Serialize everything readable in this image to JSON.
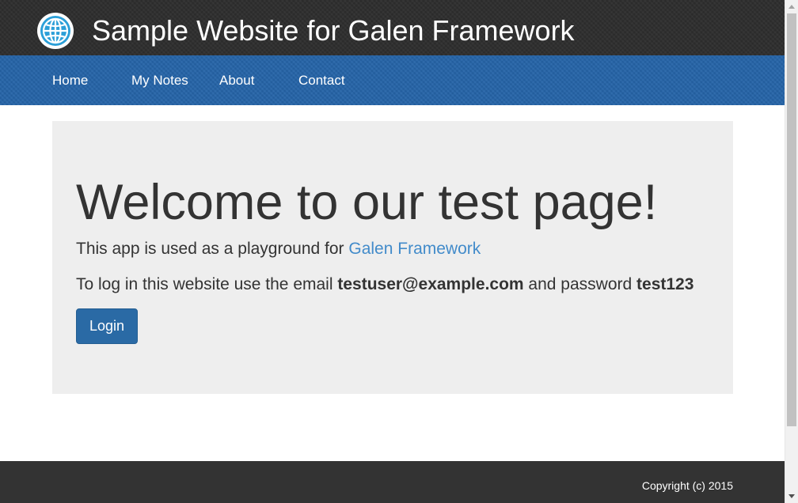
{
  "header": {
    "title": "Sample Website for Galen Framework",
    "logo_icon": "globe-icon",
    "logo_color": "#2b9fd8"
  },
  "nav": {
    "items": [
      {
        "label": "Home"
      },
      {
        "label": "My Notes"
      },
      {
        "label": "About"
      },
      {
        "label": "Contact"
      }
    ],
    "background": "#2564a8"
  },
  "jumbotron": {
    "heading": "Welcome to our test page!",
    "intro_text": "This app is used as a playground for ",
    "intro_link": "Galen Framework",
    "login_text_prefix": "To log in this website use the email ",
    "email": "testuser@example.com",
    "login_text_middle": " and password ",
    "password": "test123",
    "login_button": "Login"
  },
  "footer": {
    "copyright": "Copyright (c) 2015"
  },
  "colors": {
    "header_bg": "#2d2d2d",
    "nav_bg": "#2564a8",
    "jumbotron_bg": "#eeeeee",
    "button_bg": "#2a6aa5",
    "link": "#428bca",
    "footer_bg": "#333333"
  }
}
